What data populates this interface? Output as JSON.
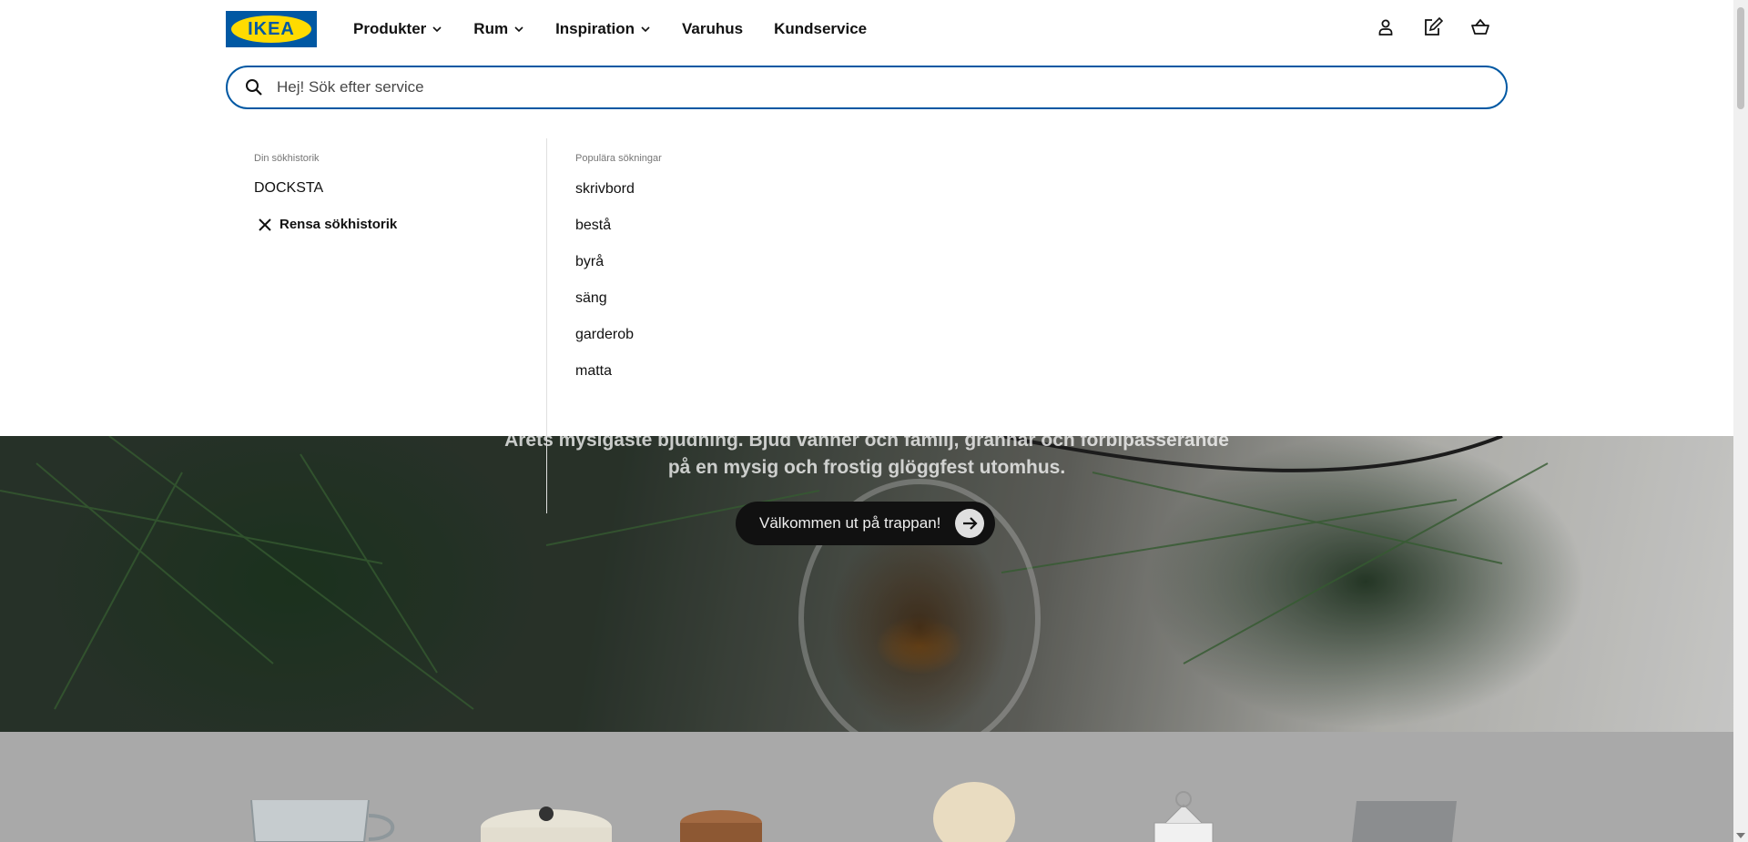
{
  "header": {
    "logo_text": "IKEA",
    "nav": [
      {
        "label": "Produkter",
        "has_dropdown": true
      },
      {
        "label": "Rum",
        "has_dropdown": true
      },
      {
        "label": "Inspiration",
        "has_dropdown": true
      },
      {
        "label": "Varuhus",
        "has_dropdown": false
      },
      {
        "label": "Kundservice",
        "has_dropdown": false
      }
    ],
    "icons": [
      "user-icon",
      "shopping-list-icon",
      "cart-icon"
    ]
  },
  "search": {
    "value": "",
    "placeholder": "Hej! Sök efter service"
  },
  "dropdown": {
    "history_title": "Din sökhistorik",
    "history": [
      "DOCKSTA"
    ],
    "clear_label": "Rensa sökhistorik",
    "popular_title": "Populära sökningar",
    "popular": [
      "skrivbord",
      "bestå",
      "byrå",
      "säng",
      "garderob",
      "matta"
    ]
  },
  "hero": {
    "text_line1": "Årets mysigaste bjudning. Bjud vänner och familj, grannar och förbipasserande",
    "text_line2": "på en mysig och frostig glöggfest utomhus.",
    "cta_label": "Välkommen ut på trappan!"
  },
  "colors": {
    "brand_blue": "#0058a3",
    "brand_yellow": "#ffdb00",
    "text": "#111111",
    "muted": "#767676"
  }
}
